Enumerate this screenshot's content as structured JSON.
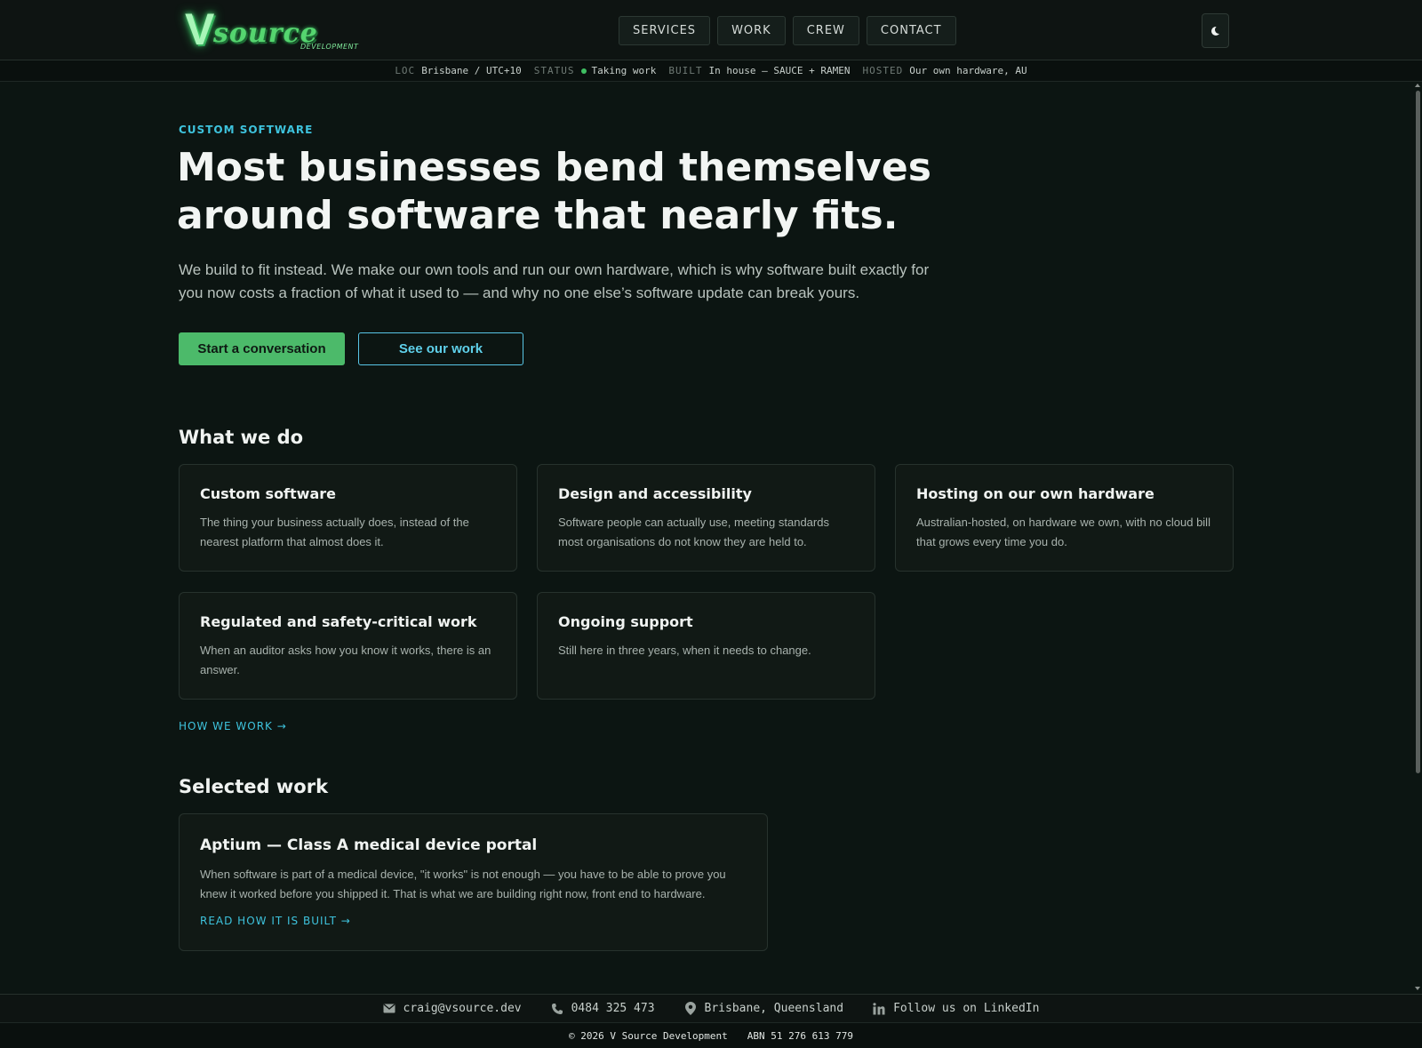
{
  "brand": {
    "logo_mark": "V",
    "logo_word": "source",
    "logo_sub": "DEVELOPMENT"
  },
  "nav": {
    "items": [
      "SERVICES",
      "WORK",
      "CREW",
      "CONTACT"
    ]
  },
  "theme_toggle": {
    "icon": "moon-icon"
  },
  "status_strip": {
    "loc_key": "LOC",
    "loc_val": "Brisbane / UTC+10",
    "status_key": "STATUS",
    "status_val": "Taking work",
    "built_key": "BUILT",
    "built_val": "In house — SAUCE + RAMEN",
    "hosted_key": "HOSTED",
    "hosted_val": "Our own hardware, AU"
  },
  "hero": {
    "eyebrow": "CUSTOM SOFTWARE",
    "headline_line1": "Most businesses bend themselves",
    "headline_line2": "around software that nearly fits.",
    "lede": "We build to fit instead. We make our own tools and run our own hardware, which is why software built exactly for you now costs a fraction of what it used to — and why no one else’s software update can break yours.",
    "primary_cta": "Start a conversation",
    "secondary_cta": "See our work"
  },
  "services": {
    "title": "What we do",
    "cards": [
      {
        "title": "Custom software",
        "body": "The thing your business actually does, instead of the nearest platform that almost does it."
      },
      {
        "title": "Design and accessibility",
        "body": "Software people can actually use, meeting standards most organisations do not know they are held to."
      },
      {
        "title": "Hosting on our own hardware",
        "body": "Australian-hosted, on hardware we own, with no cloud bill that grows every time you do."
      },
      {
        "title": "Regulated and safety-critical work",
        "body": "When an auditor asks how you know it works, there is an answer."
      },
      {
        "title": "Ongoing support",
        "body": "Still here in three years, when it needs to change."
      }
    ],
    "link": "HOW WE WORK →"
  },
  "work": {
    "title": "Selected work",
    "card_title": "Aptium — Class A medical device portal",
    "card_body": "When software is part of a medical device, \"it works\" is not enough — you have to be able to prove you knew it worked before you shipped it. That is what we are building right now, front end to hardware.",
    "card_link": "READ HOW IT IS BUILT →"
  },
  "footer": {
    "email": "craig@vsource.dev",
    "phone": "0484 325 473",
    "location": "Brisbane, Queensland",
    "linkedin": "Follow us on LinkedIn",
    "copyright": "© 2026 V Source Development",
    "abn": "ABN 51 276 613 779"
  },
  "colors": {
    "background": "#0c1512",
    "accent_green": "#4cba6a",
    "accent_cyan": "#3ec3dd"
  }
}
